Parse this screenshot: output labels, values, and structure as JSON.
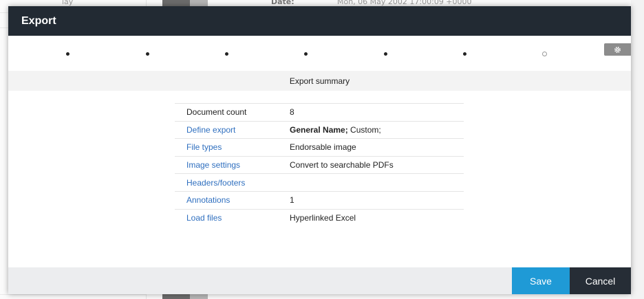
{
  "background": {
    "top_text": "lay",
    "date_label": "Date:",
    "date_value": "Mon, 06 May 2002 17:00:09 +0000"
  },
  "modal": {
    "title": "Export",
    "steps": [
      {
        "state": "done"
      },
      {
        "state": "done"
      },
      {
        "state": "done"
      },
      {
        "state": "done"
      },
      {
        "state": "done"
      },
      {
        "state": "done"
      },
      {
        "state": "pending"
      }
    ],
    "gear_icon": "gear-icon",
    "summary_title": "Export summary",
    "rows": [
      {
        "label": "Document count",
        "value": "8"
      },
      {
        "label": "Define export",
        "value_bold": "General Name;",
        "value_rest": " Custom;"
      },
      {
        "label": "File types",
        "value": "Endorsable image"
      },
      {
        "label": "Image settings",
        "value": "Convert to searchable PDFs"
      },
      {
        "label": "Headers/footers",
        "value": ""
      },
      {
        "label": "Annotations",
        "value": "1"
      },
      {
        "label": "Load files",
        "value": "Hyperlinked Excel"
      }
    ],
    "footer": {
      "save_label": "Save",
      "cancel_label": "Cancel"
    },
    "colors": {
      "header_bg": "#222a33",
      "link": "#2f6fbf",
      "save_bg": "#1f9ad6",
      "cancel_bg": "#262d36"
    }
  }
}
